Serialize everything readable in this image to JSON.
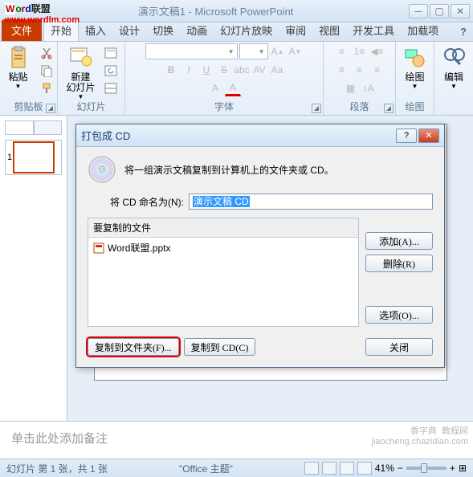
{
  "app": {
    "title": "演示文稿1 - Microsoft PowerPoint",
    "logo_line1_parts": {
      "w": "W",
      "o": "o",
      "r": "r",
      "d": "d",
      "lm": "联盟"
    },
    "logo_line2": "www.wordlm.com"
  },
  "tabs": {
    "file": "文件",
    "items": [
      "开始",
      "插入",
      "设计",
      "切换",
      "动画",
      "幻灯片放映",
      "审阅",
      "视图",
      "开发工具",
      "加载项"
    ],
    "active_index": 0
  },
  "ribbon": {
    "clipboard": {
      "label": "剪贴板",
      "paste": "粘贴"
    },
    "slides": {
      "label": "幻灯片",
      "new": "新建\n幻灯片"
    },
    "font": {
      "label": "字体"
    },
    "paragraph": {
      "label": "段落"
    },
    "drawing": {
      "label": "绘图",
      "draw": "绘图"
    },
    "editing": {
      "label": "",
      "edit": "编辑"
    }
  },
  "thumb": {
    "num": "1"
  },
  "notes": {
    "placeholder": "单击此处添加备注"
  },
  "status": {
    "left": "幻灯片 第 1 张，共 1 张",
    "theme": "\"Office 主题\"",
    "zoom": "41%",
    "fit_icon": "⊞"
  },
  "dialog": {
    "title": "打包成 CD",
    "desc": "将一组演示文稿复制到计算机上的文件夹或 CD。",
    "name_label": "将 CD 命名为(N):",
    "name_value": "演示文稿 CD",
    "files_header": "要复制的文件",
    "file_item": "Word联盟.pptx",
    "btn_add": "添加(A)...",
    "btn_remove": "删除(R)",
    "btn_options": "选项(O)...",
    "btn_copy_folder": "复制到文件夹(F)...",
    "btn_copy_cd": "复制到 CD(C)",
    "btn_close": "关闭",
    "help": "?",
    "close_x": "✕"
  },
  "watermark": "香字典  教程网\njiaocheng.chazidian.com"
}
